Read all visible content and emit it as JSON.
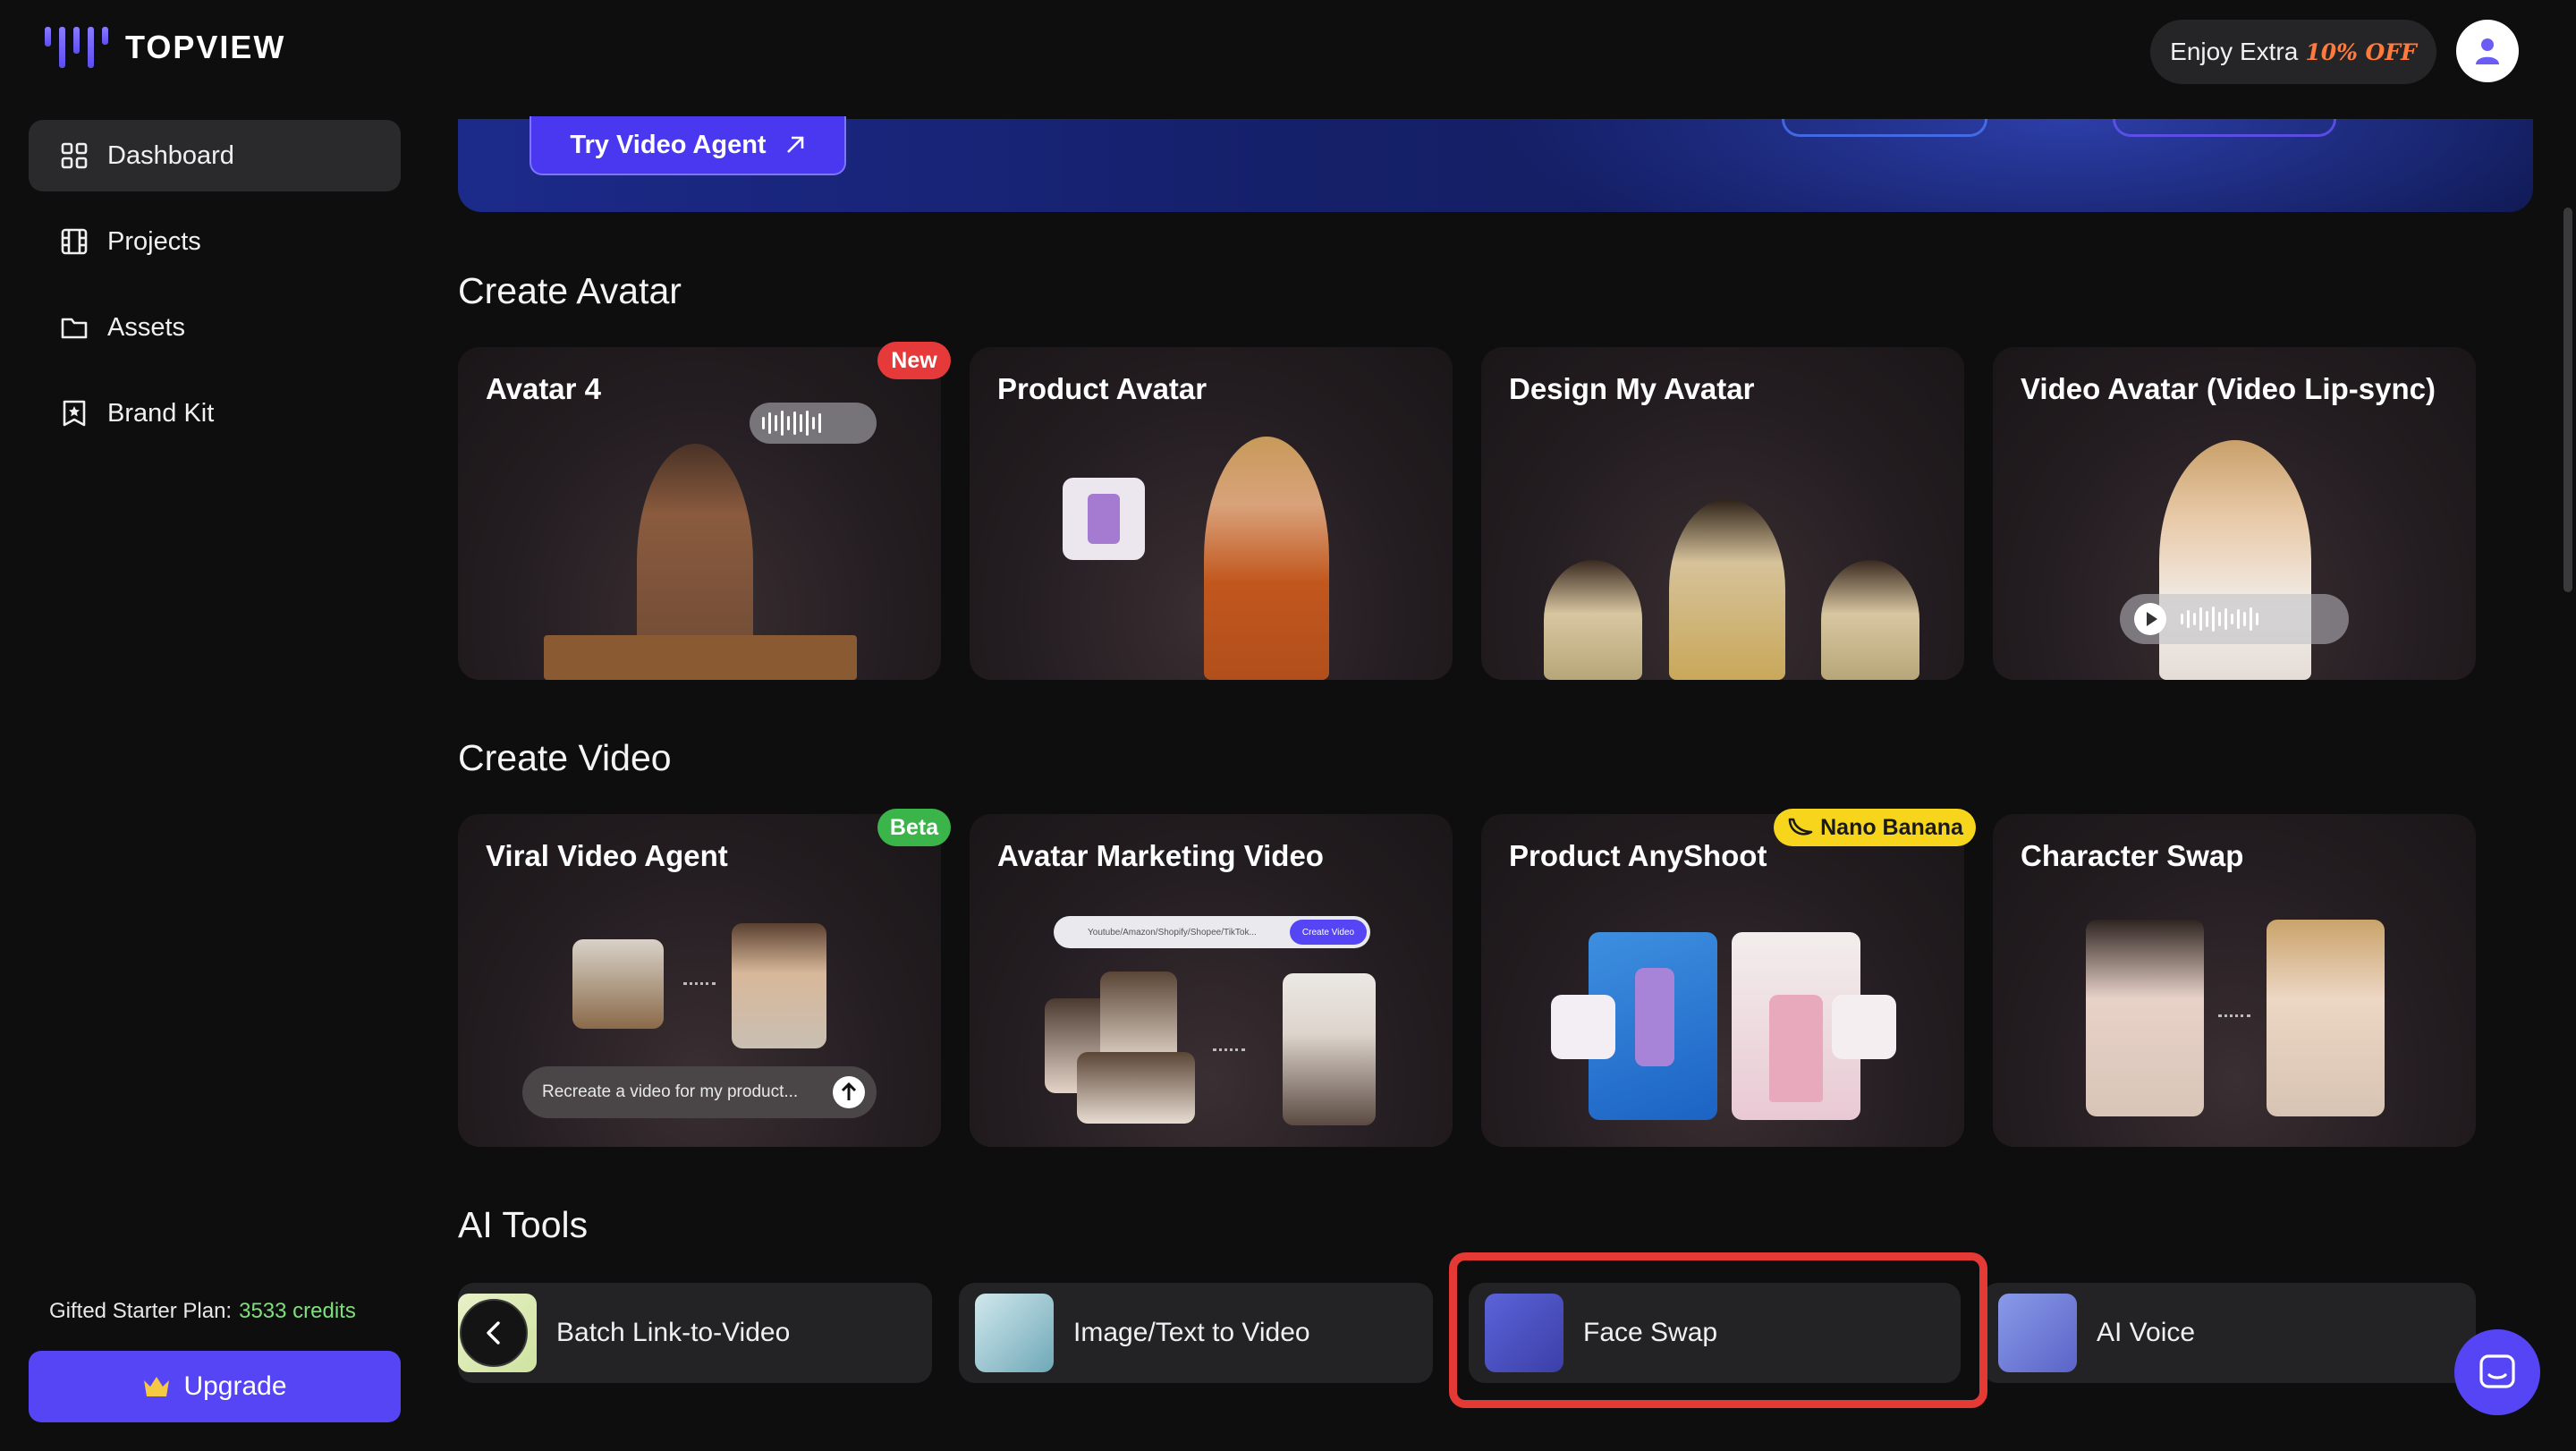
{
  "app": {
    "name": "TOPVIEW"
  },
  "header": {
    "promo_prefix": "Enjoy Extra",
    "promo_highlight": "10% OFF",
    "avatar_icon": "user-icon"
  },
  "sidebar": {
    "items": [
      {
        "label": "Dashboard",
        "icon": "grid-icon",
        "active": true
      },
      {
        "label": "Projects",
        "icon": "film-icon",
        "active": false
      },
      {
        "label": "Assets",
        "icon": "folder-icon",
        "active": false
      },
      {
        "label": "Brand Kit",
        "icon": "star-badge-icon",
        "active": false
      }
    ],
    "plan_label": "Gifted Starter Plan:",
    "plan_credits": "3533 credits",
    "upgrade_label": "Upgrade"
  },
  "hero": {
    "cta_label": "Try Video Agent"
  },
  "sections": {
    "create_avatar": {
      "title": "Create Avatar",
      "cards": [
        {
          "title": "Avatar 4",
          "tag": "New"
        },
        {
          "title": "Product Avatar"
        },
        {
          "title": "Design My Avatar"
        },
        {
          "title": "Video Avatar (Video Lip-sync)"
        }
      ]
    },
    "create_video": {
      "title": "Create Video",
      "cards": [
        {
          "title": "Viral Video Agent",
          "tag": "Beta",
          "prompt_text": "Recreate a video for my product..."
        },
        {
          "title": "Avatar Marketing Video",
          "url_text": "Youtube/Amazon/Shopify/Shopee/TikTok...",
          "cta_text": "Create Video"
        },
        {
          "title": "Product AnyShoot",
          "tag": "Nano Banana"
        },
        {
          "title": "Character Swap"
        }
      ]
    },
    "ai_tools": {
      "title": "AI Tools",
      "items": [
        {
          "label": "Batch Link-to-Video"
        },
        {
          "label": "Image/Text to Video"
        },
        {
          "label": "Face Swap",
          "highlighted": true
        },
        {
          "label": "AI Voice"
        }
      ]
    }
  },
  "colors": {
    "accent": "#5645f5",
    "background": "#0e0e0f",
    "credits": "#7ee07a",
    "highlight_border": "#e53935"
  }
}
